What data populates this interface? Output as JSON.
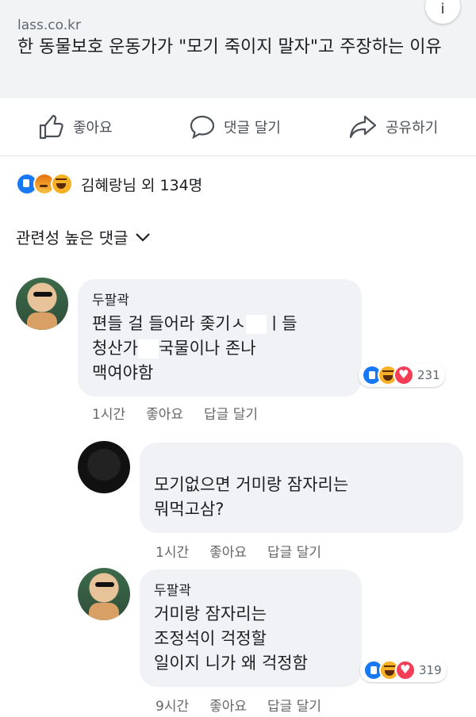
{
  "link": {
    "domain": "lass.co.kr",
    "title": "한 동물보호 운동가가 \"모기 죽이지 말자\"고 주장하는 이유",
    "info_icon": "i"
  },
  "actions": {
    "like": "좋아요",
    "comment": "댓글 달기",
    "share": "공유하기"
  },
  "reactions_summary": {
    "icons": [
      "like",
      "angry",
      "haha"
    ],
    "text": "김혜랑님 외 134명"
  },
  "sort_label": "관련성 높은 댓글",
  "comments": [
    {
      "author": "두팔곽",
      "line1": "편들 걸 들어라 좆기ㅅ",
      "line1b": "ㅣ들",
      "line2": "청산가",
      "line2b": "국물이나 존나",
      "line3": "맥여야함",
      "reactions": [
        "like",
        "haha",
        "love"
      ],
      "reaction_count": "231",
      "time": "1시간",
      "like": "좋아요",
      "reply": "답글 달기"
    },
    {
      "author": "",
      "line1": "모기없으면 거미랑 잠자리는",
      "line2": "뭐먹고삼?",
      "time": "1시간",
      "like": "좋아요",
      "reply": "답글 달기"
    },
    {
      "author": "두팔곽",
      "line1": "거미랑 잠자리는",
      "line2": "조정석이 걱정할",
      "line3": "일이지 니가 왜 걱정함",
      "reactions": [
        "like",
        "haha",
        "love"
      ],
      "reaction_count": "319",
      "time": "9시간",
      "like": "좋아요",
      "reply": "답글 달기"
    }
  ]
}
